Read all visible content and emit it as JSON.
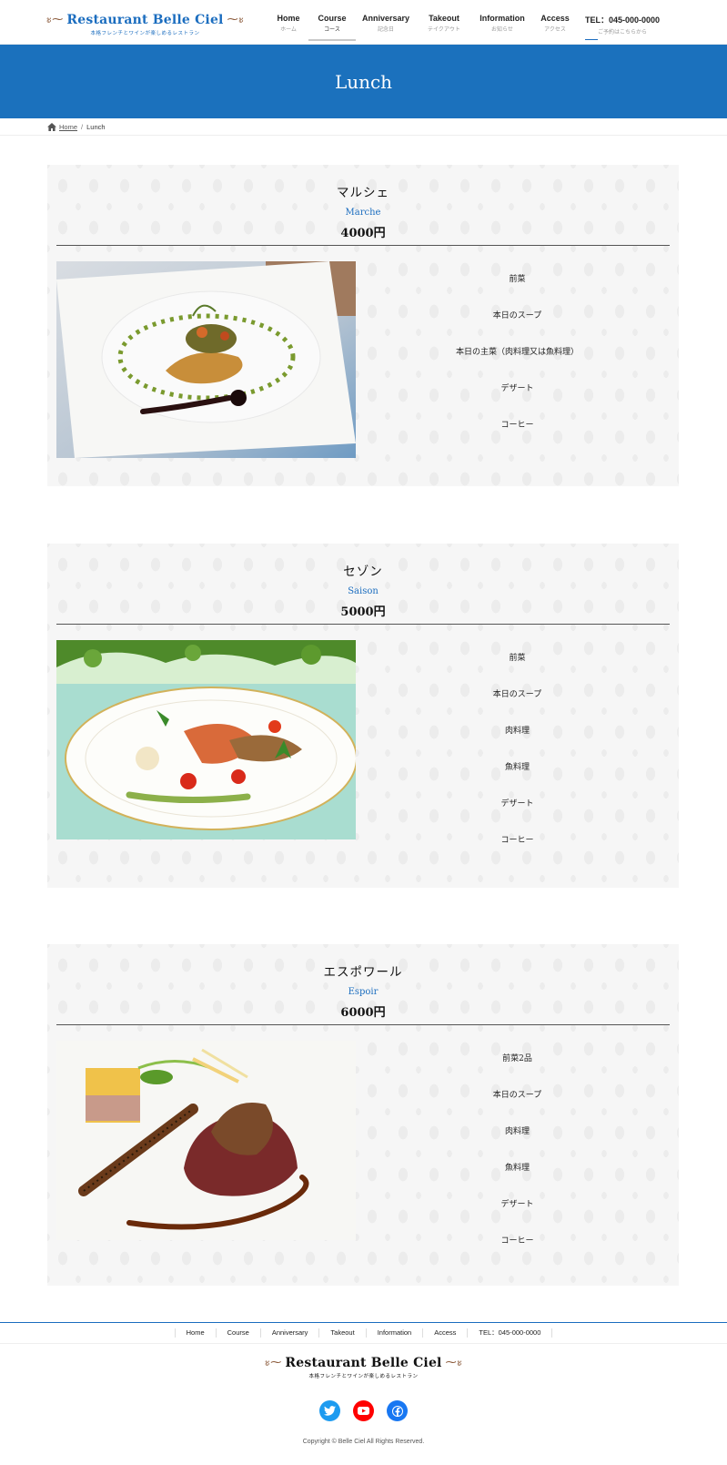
{
  "header": {
    "logo_title": "Restaurant Belle Ciel",
    "logo_subtitle": "本格フレンチとワインが楽しめるレストラン",
    "nav": [
      {
        "label": "Home",
        "sub": "ホーム"
      },
      {
        "label": "Course",
        "sub": "コース"
      },
      {
        "label": "Anniversary",
        "sub": "記念日"
      },
      {
        "label": "Takeout",
        "sub": "テイクアウト"
      },
      {
        "label": "Information",
        "sub": "お知らせ"
      },
      {
        "label": "Access",
        "sub": "アクセス"
      },
      {
        "label": "TEL：045-000-0000",
        "sub": "ご予約はこちらから"
      }
    ]
  },
  "page_title": "Lunch",
  "breadcrumb": {
    "home": "Home",
    "separator": "/",
    "current": "Lunch"
  },
  "courses": [
    {
      "name": "マルシェ",
      "name_en": "Marche",
      "price": "4000円",
      "items": [
        "前菜",
        "本日のスープ",
        "本日の主菜（肉料理又は魚料理）",
        "デザート",
        "コーヒー"
      ]
    },
    {
      "name": "セゾン",
      "name_en": "Saison",
      "price": "5000円",
      "items": [
        "前菜",
        "本日のスープ",
        "肉料理",
        "魚料理",
        "デザート",
        "コーヒー"
      ]
    },
    {
      "name": "エスポワール",
      "name_en": "Espoir",
      "price": "6000円",
      "items": [
        "前菜2品",
        "本日のスープ",
        "肉料理",
        "魚料理",
        "デザート",
        "コーヒー"
      ]
    }
  ],
  "footer": {
    "nav": [
      "Home",
      "Course",
      "Anniversary",
      "Takeout",
      "Information",
      "Access",
      "TEL：045-000-0000"
    ],
    "logo_title": "Restaurant Belle Ciel",
    "logo_subtitle": "本格フレンチとワインが楽しめるレストラン",
    "social": [
      {
        "icon": "twitter-icon",
        "color": "#1d9bf0"
      },
      {
        "icon": "youtube-icon",
        "color": "#ff0000"
      },
      {
        "icon": "facebook-icon",
        "color": "#1877f2"
      }
    ],
    "copyright": "Copyright © Belle Ciel All Rights Reserved."
  },
  "colors": {
    "brand": "#1b6dbf",
    "banner": "#1b71bd"
  }
}
